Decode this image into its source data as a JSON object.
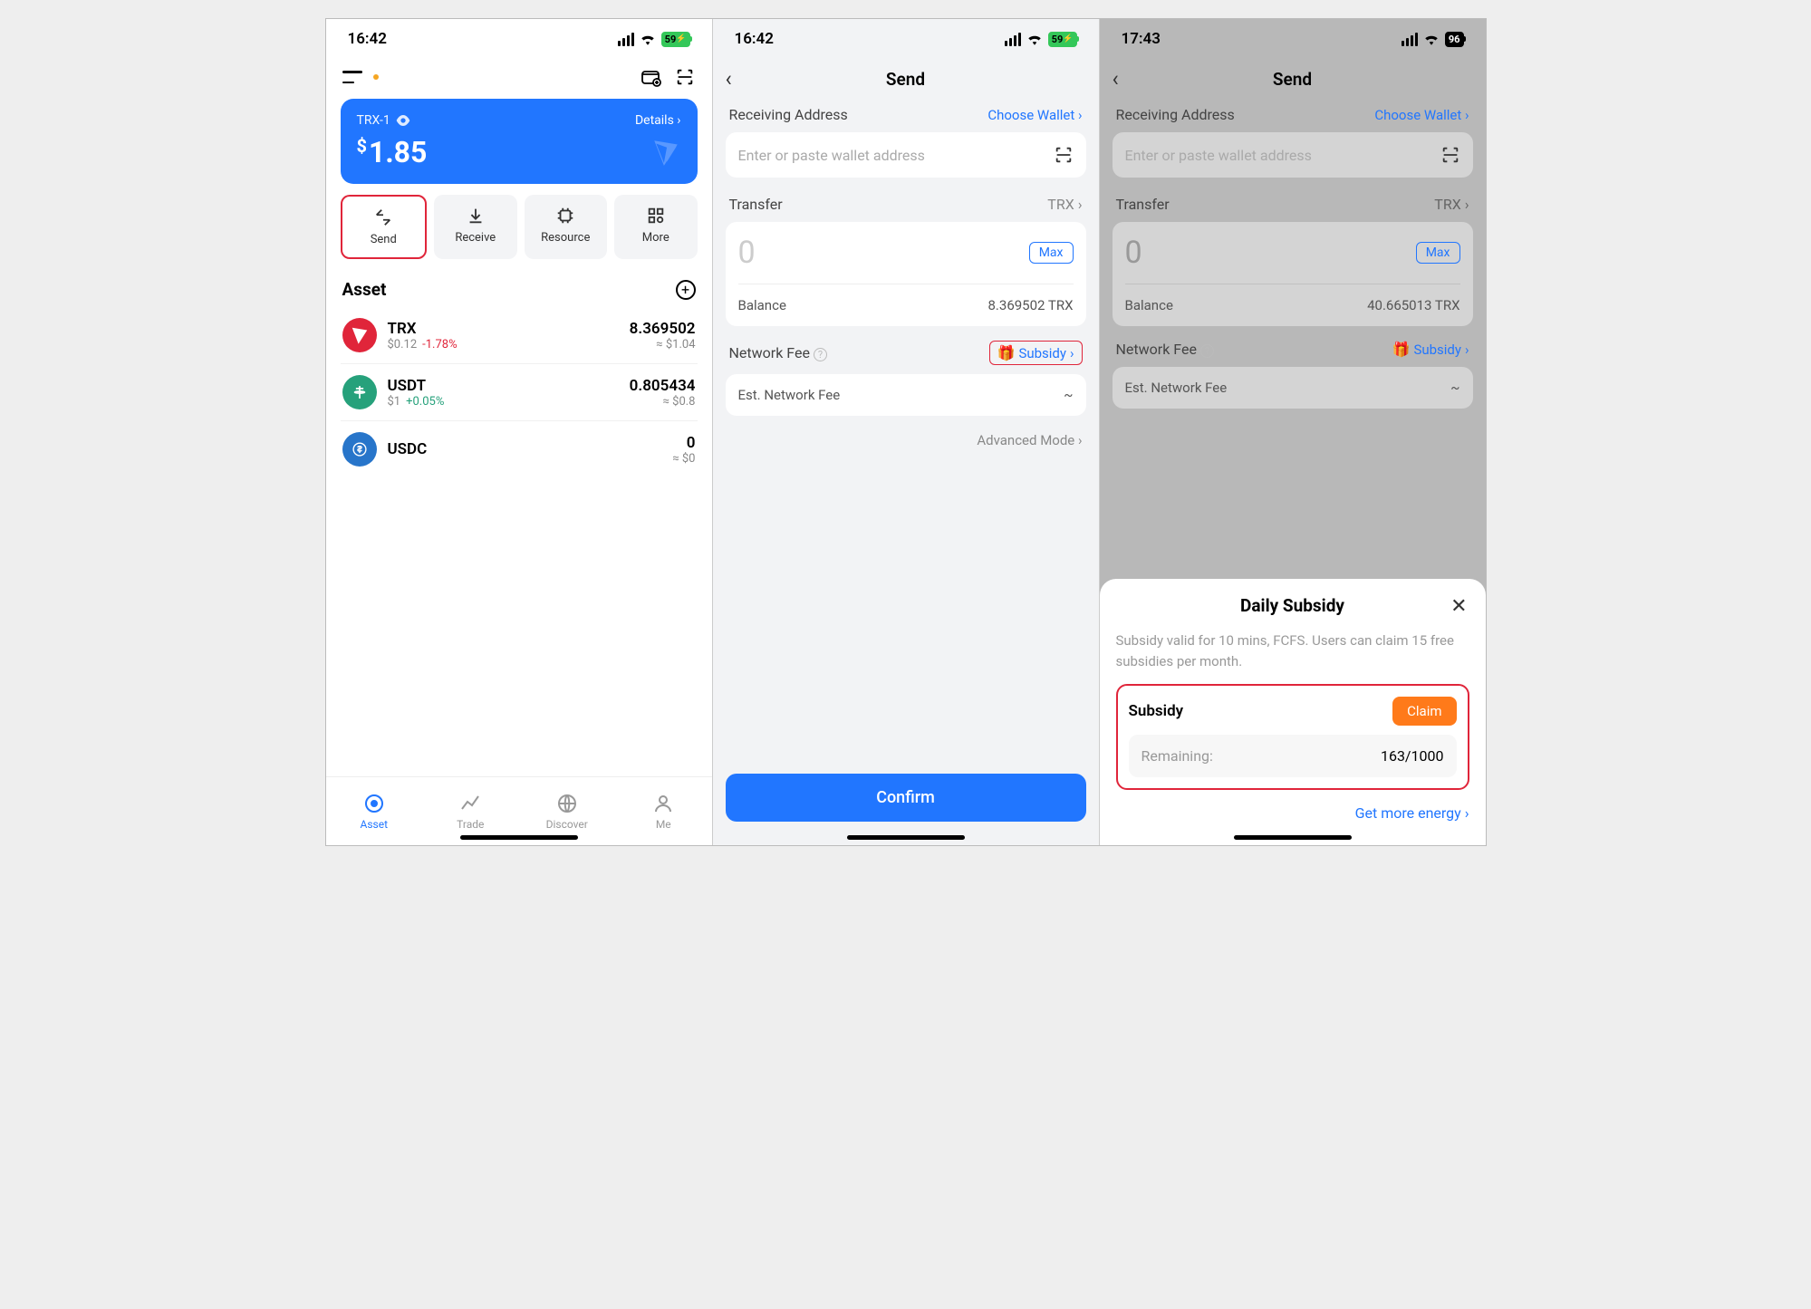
{
  "phone1": {
    "status_time": "16:42",
    "battery": "59",
    "wallet_name": "TRX-1",
    "details_label": "Details",
    "balance": "1.85",
    "actions": {
      "send": "Send",
      "receive": "Receive",
      "resource": "Resource",
      "more": "More"
    },
    "asset_header": "Asset",
    "assets": [
      {
        "sym": "TRX",
        "price": "$0.12",
        "pct": "-1.78%",
        "amt": "8.369502",
        "usd": "≈ $1.04"
      },
      {
        "sym": "USDT",
        "price": "$1",
        "pct": "+0.05%",
        "amt": "0.805434",
        "usd": "≈ $0.8"
      },
      {
        "sym": "USDC",
        "price": "",
        "pct": "",
        "amt": "0",
        "usd": "≈ $0"
      }
    ],
    "tabs": {
      "asset": "Asset",
      "trade": "Trade",
      "discover": "Discover",
      "me": "Me"
    }
  },
  "phone2": {
    "status_time": "16:42",
    "battery": "59",
    "title": "Send",
    "recv_label": "Receiving Address",
    "choose_wallet": "Choose Wallet",
    "addr_placeholder": "Enter or paste wallet address",
    "transfer_label": "Transfer",
    "transfer_coin": "TRX",
    "amount_placeholder": "0",
    "max_label": "Max",
    "balance_label": "Balance",
    "balance_value": "8.369502 TRX",
    "network_fee": "Network Fee",
    "subsidy_label": "Subsidy",
    "est_fee": "Est. Network Fee",
    "est_value": "~",
    "adv_mode": "Advanced Mode",
    "confirm": "Confirm"
  },
  "phone3": {
    "status_time": "17:43",
    "battery": "96",
    "title": "Send",
    "recv_label": "Receiving Address",
    "choose_wallet": "Choose Wallet",
    "addr_placeholder": "Enter or paste wallet address",
    "transfer_label": "Transfer",
    "transfer_coin": "TRX",
    "amount_placeholder": "0",
    "max_label": "Max",
    "balance_label": "Balance",
    "balance_value": "40.665013 TRX",
    "network_fee": "Network Fee",
    "subsidy_label": "Subsidy",
    "est_fee": "Est. Network Fee",
    "est_value": "~",
    "sheet": {
      "title": "Daily Subsidy",
      "note": "Subsidy valid for 10 mins, FCFS. Users can claim 15 free subsidies per month.",
      "subsidy_label": "Subsidy",
      "claim": "Claim",
      "remaining_label": "Remaining:",
      "remaining_value": "163/1000",
      "get_more": "Get more energy"
    }
  }
}
